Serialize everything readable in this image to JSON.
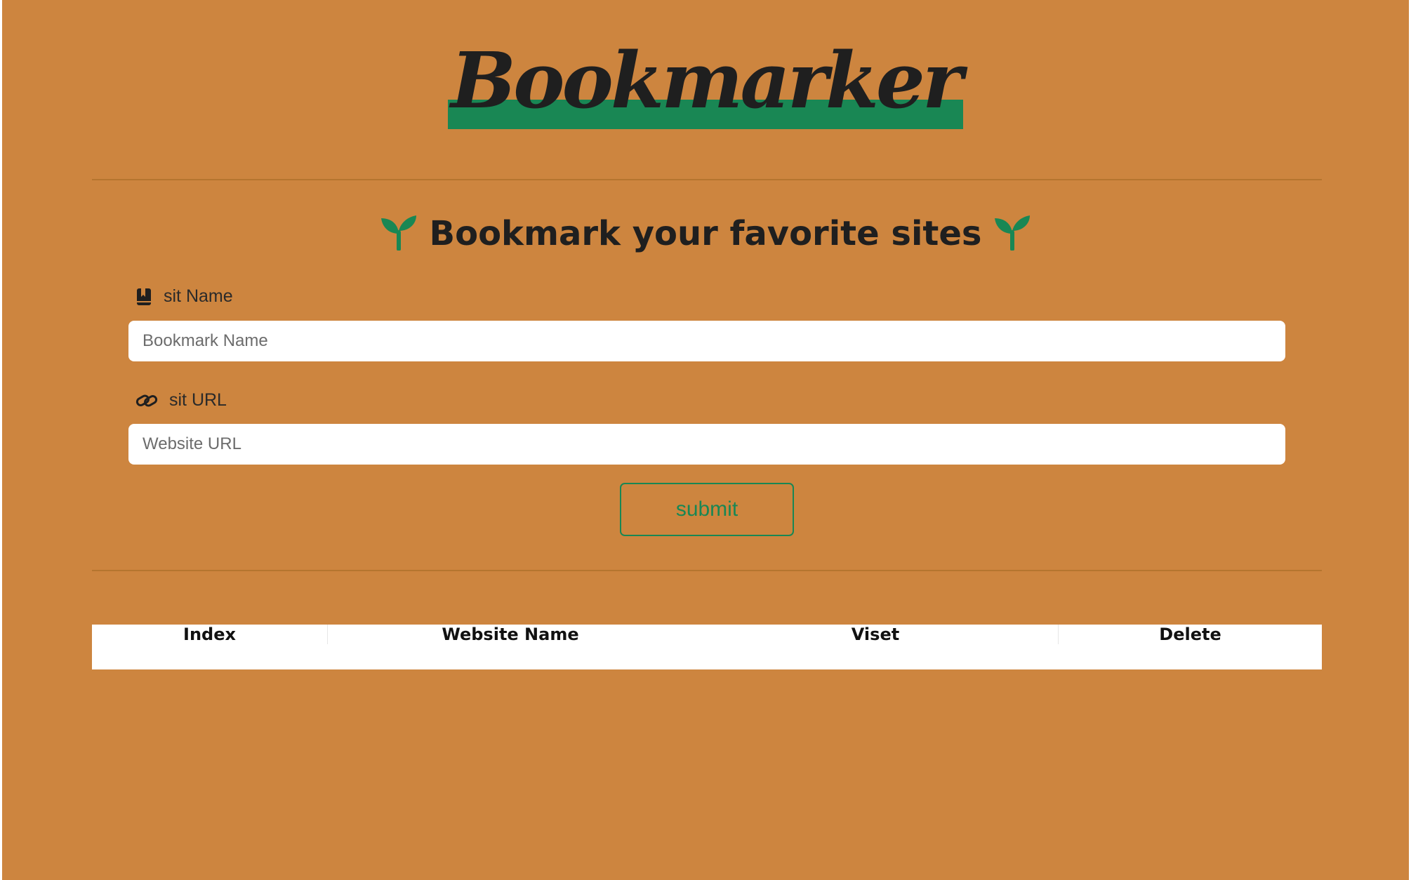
{
  "header": {
    "logo_text": "Bookmarker",
    "accent_color": "#198754",
    "background_color": "#cd853f"
  },
  "main": {
    "heading": "Bookmark your favorite sites",
    "heading_icon": "seedling-icon"
  },
  "form": {
    "name_label": "sit Name",
    "name_icon": "bookmark-icon",
    "name_placeholder": "Bookmark Name",
    "name_value": "",
    "url_label": "sit URL",
    "url_icon": "link-icon",
    "url_placeholder": "Website URL",
    "url_value": "",
    "submit_label": "submit"
  },
  "table": {
    "headers": [
      "Index",
      "Website Name",
      "Viset",
      "Delete"
    ],
    "rows": []
  }
}
